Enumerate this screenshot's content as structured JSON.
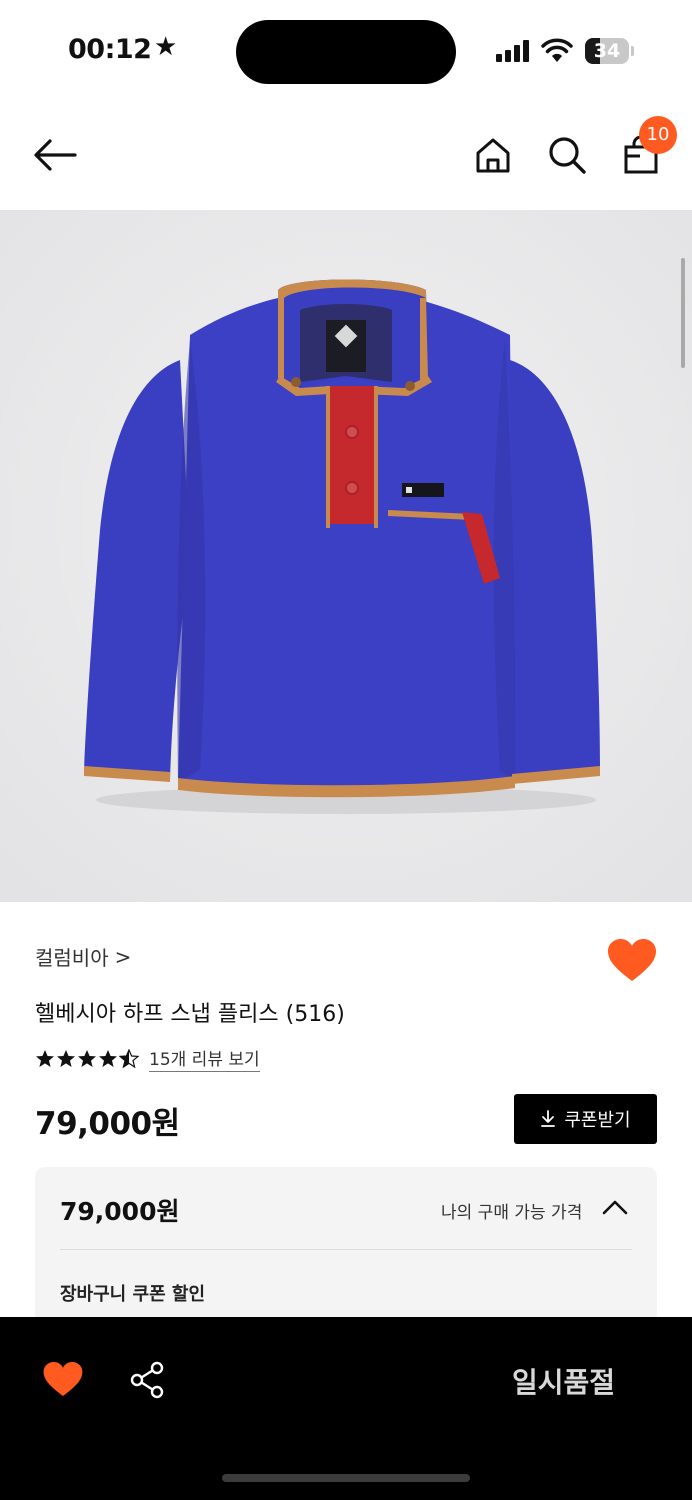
{
  "status_bar": {
    "time": "00:12",
    "star_icon": "★",
    "battery": "34",
    "battery_level": 0.34
  },
  "header": {
    "back_icon": "arrow-left-icon",
    "home_icon": "home-icon",
    "search_icon": "search-icon",
    "cart_icon": "shopping-bag-icon",
    "cart_count": "10"
  },
  "product": {
    "brand": "컬럼비아",
    "brand_chevron": ">",
    "name": "헬베시아 하프 스냅 플리스 (516)",
    "rating": 4.5,
    "review_link": "15개 리뷰 보기",
    "price": "79,000원",
    "coupon_button": "쿠폰받기",
    "wishlisted": true
  },
  "price_panel": {
    "price": "79,000원",
    "label": "나의 구매 가능 가격",
    "discount_label": "장바구니 쿠폰 할인"
  },
  "bottom_bar": {
    "status": "일시품절"
  },
  "colors": {
    "accent": "#ff5a1f",
    "fleece_blue": "#3a3ec0",
    "trim_tan": "#c98a4e",
    "placket_red": "#c5282d"
  }
}
